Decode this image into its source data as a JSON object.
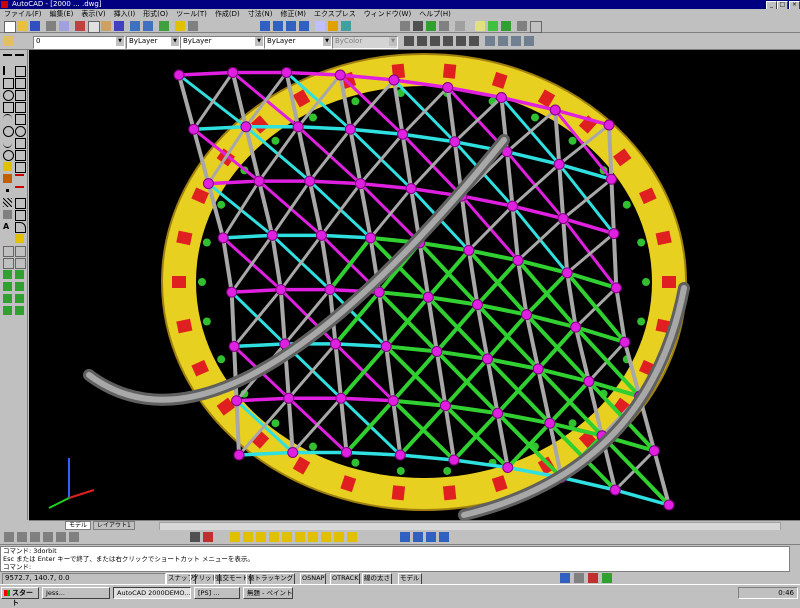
{
  "window": {
    "title": "AutoCAD - [2000 ... .dwg]",
    "minimize": "_",
    "restore": "□",
    "close": "×"
  },
  "menu": {
    "items": [
      "ファイル(F)",
      "編集(E)",
      "表示(V)",
      "挿入(I)",
      "形式(O)",
      "ツール(T)",
      "作成(D)",
      "寸法(N)",
      "修正(M)",
      "エクスプレス",
      "ウィンドウ(W)",
      "ヘルプ(H)"
    ]
  },
  "properties_toolbar": {
    "layer_value": "0",
    "color_value": "ByLayer",
    "linetype_value": "ByLayer",
    "lineweight_value": "ByLayer",
    "plotstyle_value": "ByColor"
  },
  "layout_tabs": [
    "モデル",
    "レイアウト1"
  ],
  "command_line": {
    "lines": [
      "コマンド: 3dorbit",
      "Esc または Enter キーで終了、または右クリックでショートカット メニューを表示。",
      "コマンド:"
    ]
  },
  "status": {
    "coordinates": "9572.7, 140.7, 0.0",
    "modes": [
      "スナップ",
      "グリッド",
      "直交モード",
      "極トラッキング",
      "OSNAP",
      "OTRACK",
      "線の太さ",
      "モデル"
    ]
  },
  "taskbar": {
    "start_label": "スタート",
    "tasks": [
      {
        "label": "Jess...",
        "active": false
      },
      {
        "label": "AutoCAD 2000DEMO...",
        "active": true
      },
      {
        "label": "[PS] ...",
        "active": false
      },
      {
        "label": "無題 - ペイント",
        "active": false
      }
    ],
    "clock": "0:46"
  },
  "colors": {
    "background": "#000000",
    "strut_magenta": "#e020e0",
    "strut_cyan": "#30e0e0",
    "strut_green": "#30d030",
    "strut_gray": "#a8a8a8",
    "ring_yellow": "#e8d020",
    "panel_red": "#e02020"
  },
  "icons": {
    "ucs": "ucs-axes-icon"
  }
}
